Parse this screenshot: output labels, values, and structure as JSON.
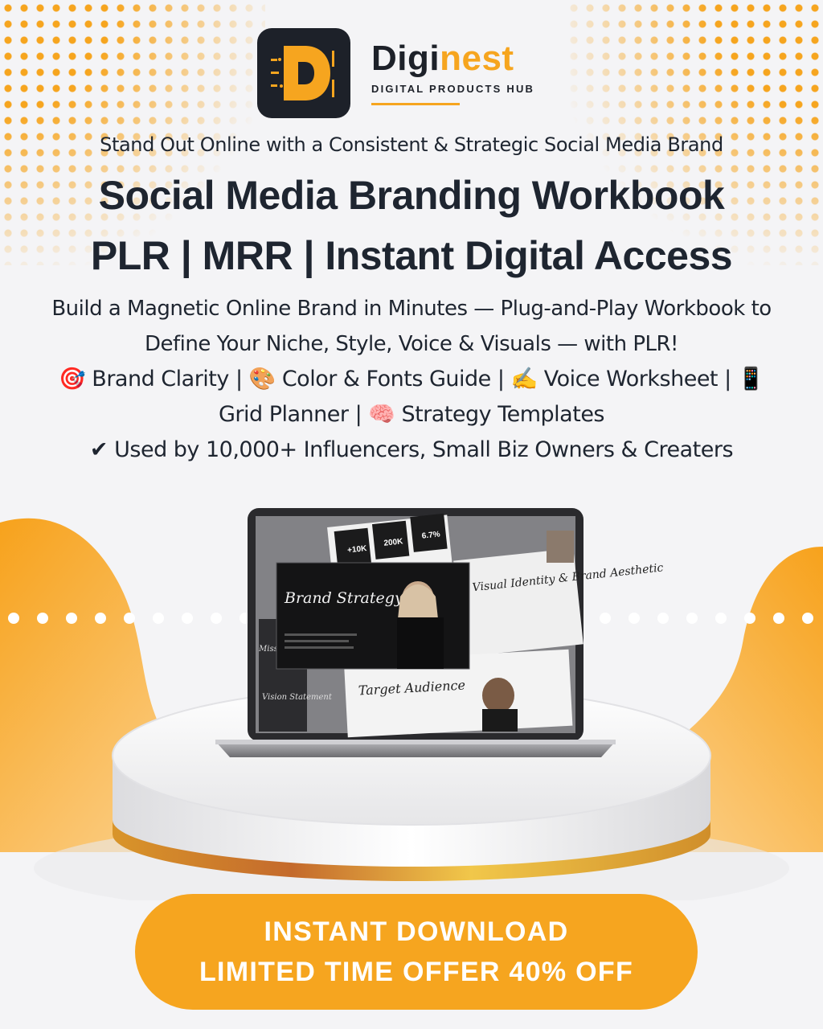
{
  "brand": {
    "name_part1": "Digi",
    "name_part2": "nest",
    "tagline": "DIGITAL PRODUCTS HUB"
  },
  "subtitle": "Stand Out Online with a Consistent & Strategic Social Media Brand",
  "title_line1": "Social Media Branding Workbook",
  "title_line2": "PLR | MRR | Instant Digital Access",
  "description": "Build a Magnetic Online Brand in Minutes — Plug-and-Play Workbook to Define Your Niche, Style, Voice & Visuals — with PLR!",
  "features_line": "🎯 Brand Clarity | 🎨 Color & Fonts Guide | ✍️ Voice Worksheet | 📱 Grid Planner | 🧠 Strategy Templates",
  "social_proof": "✔ Used by 10,000+ Influencers, Small Biz Owners & Creaters",
  "screen": {
    "stats": [
      "+10K",
      "200K",
      "6.7%"
    ],
    "brand_strategy": "Brand Strategy",
    "visual_identity": "Visual Identity & Brand Aesthetic",
    "mission": "Mission Statement",
    "vision": "Vision Statement",
    "target_audience": "Target Audience"
  },
  "cta": {
    "line1": "INSTANT DOWNLOAD",
    "line2": "LIMITED TIME OFFER 40% OFF"
  },
  "colors": {
    "accent": "#f6a51f",
    "dark": "#1d2129",
    "text": "#1e2530",
    "background": "#f4f4f6"
  }
}
